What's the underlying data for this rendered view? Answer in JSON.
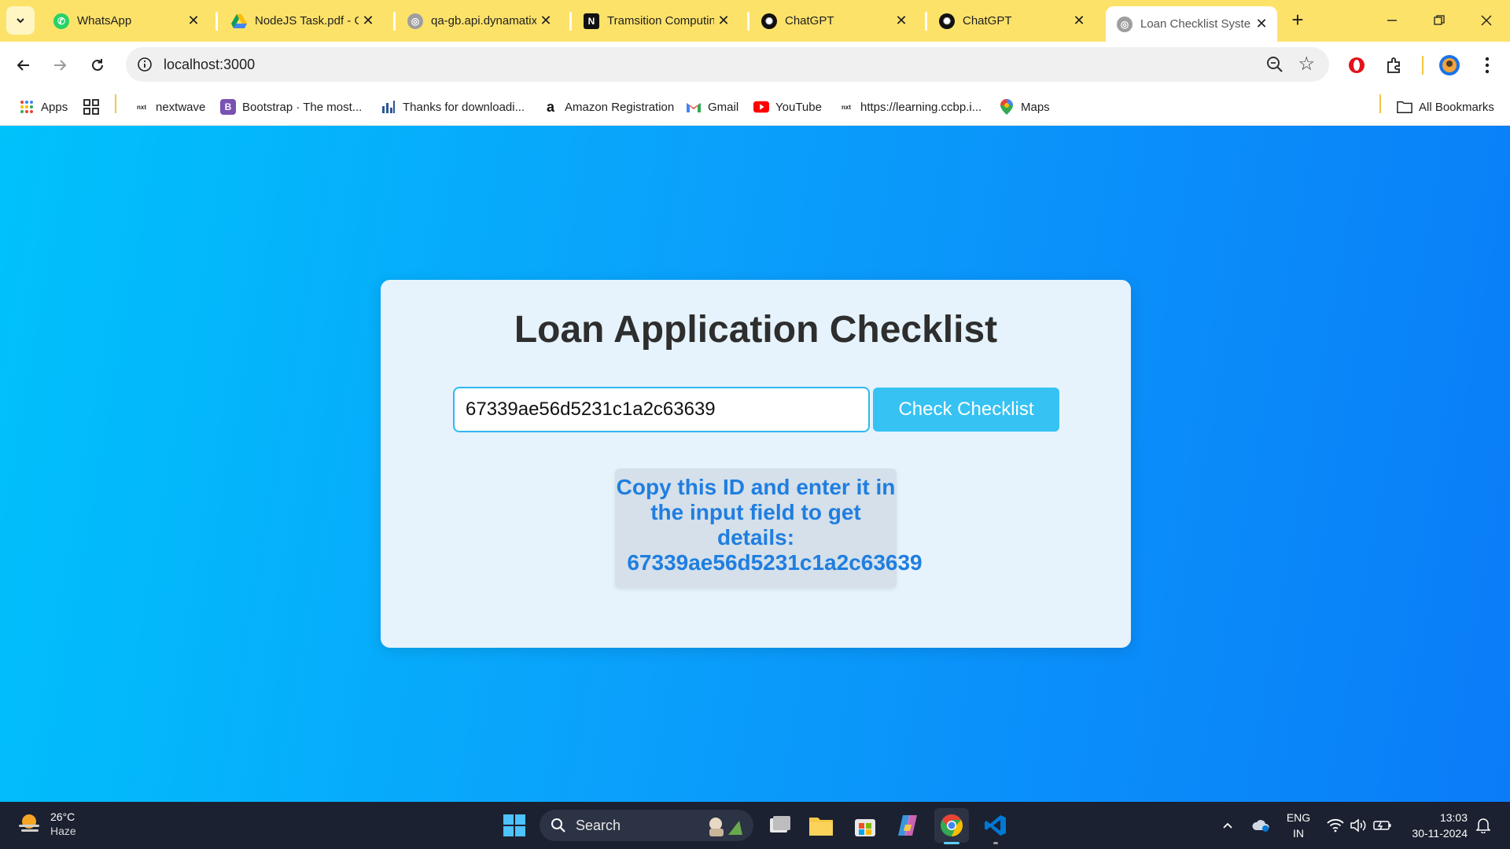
{
  "browser": {
    "tabs": [
      {
        "title": "WhatsApp",
        "icon": "whatsapp-icon"
      },
      {
        "title": "NodeJS Task.pdf - Go",
        "icon": "google-drive-icon"
      },
      {
        "title": "qa-gb.api.dynamatix",
        "icon": "globe-icon"
      },
      {
        "title": "Tramsition Computin",
        "icon": "notion-icon"
      },
      {
        "title": "ChatGPT",
        "icon": "chatgpt-icon"
      },
      {
        "title": "ChatGPT",
        "icon": "chatgpt-icon"
      },
      {
        "title": "Loan Checklist Syste",
        "icon": "globe-icon",
        "active": true
      }
    ],
    "url": "localhost:3000",
    "bookmarks": [
      {
        "label": "Apps"
      },
      {
        "label": "nextwave"
      },
      {
        "label": "Bootstrap · The most..."
      },
      {
        "label": "Thanks for downloadi..."
      },
      {
        "label": "Amazon Registration"
      },
      {
        "label": "Gmail"
      },
      {
        "label": "YouTube"
      },
      {
        "label": "https://learning.ccbp.i..."
      },
      {
        "label": "Maps"
      },
      {
        "label": "All Bookmarks"
      }
    ]
  },
  "page": {
    "title": "Loan Application Checklist",
    "input_value": "67339ae56d5231c1a2c63639",
    "button_label": "Check Checklist",
    "info_message": "Copy this ID and enter it in the input field to get details:",
    "info_id": "67339ae56d5231c1a2c63639"
  },
  "taskbar": {
    "weather_temp": "26°C",
    "weather_condition": "Haze",
    "search_label": "Search",
    "language": "ENG",
    "region": "IN",
    "time": "13:03",
    "date": "30-11-2024"
  },
  "colors": {
    "tab_strip": "#fde26a",
    "page_gradient_start": "#00c2fb",
    "page_gradient_end": "#0a7cf8",
    "card_bg": "#e6f3fc",
    "button_bg": "#36c2f2",
    "info_text": "#1f7ee0"
  }
}
